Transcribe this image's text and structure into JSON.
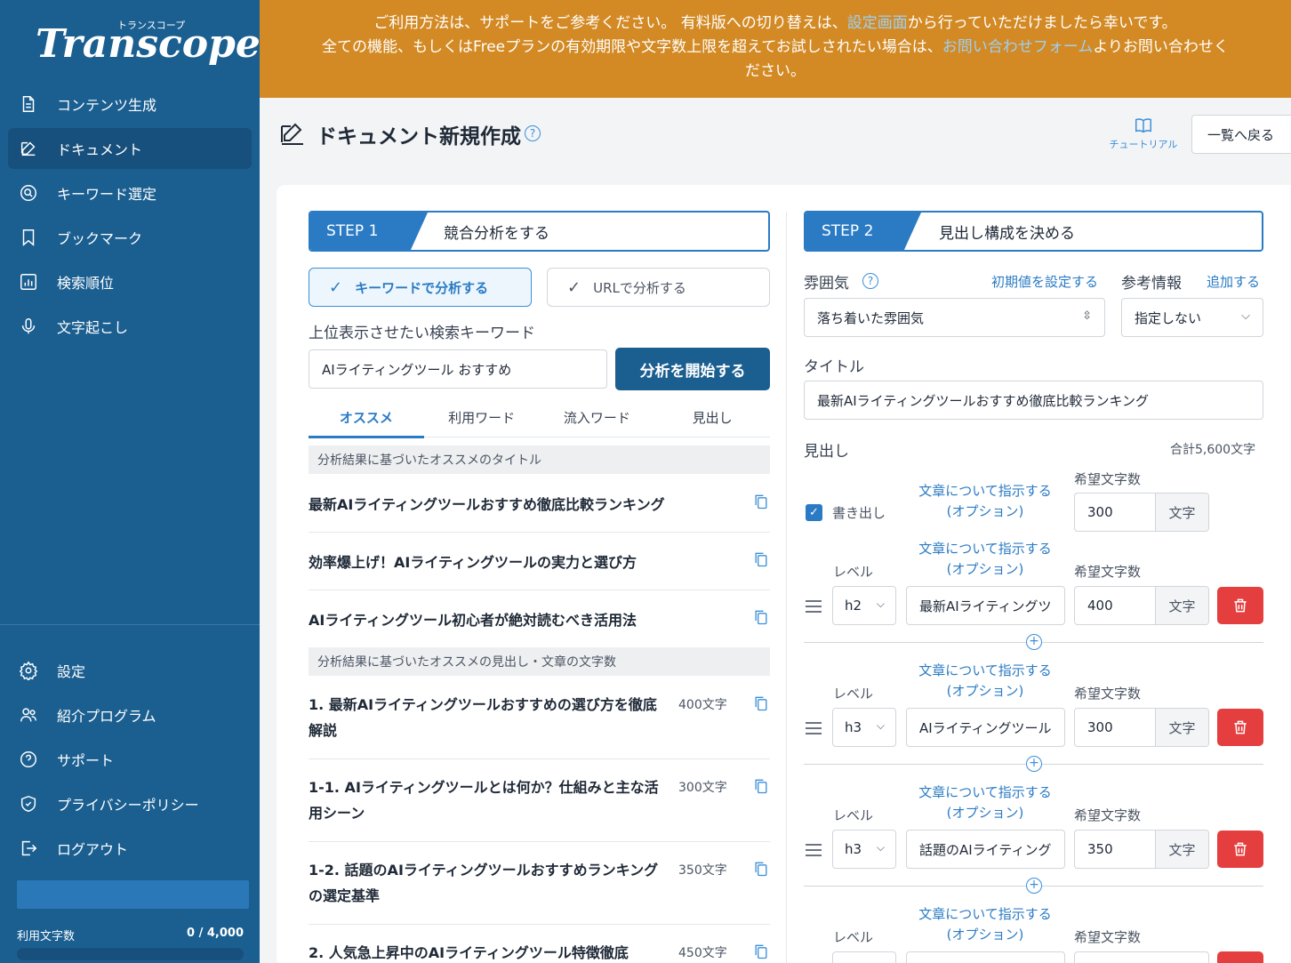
{
  "sidebar": {
    "logo": "Transcope",
    "logo_kana": "トランスコープ",
    "items": [
      {
        "label": "コンテンツ生成",
        "icon": "document-icon"
      },
      {
        "label": "ドキュメント",
        "icon": "edit-icon",
        "active": true
      },
      {
        "label": "キーワード選定",
        "icon": "search-circle-icon"
      },
      {
        "label": "ブックマーク",
        "icon": "bookmark-icon"
      },
      {
        "label": "検索順位",
        "icon": "chart-icon"
      },
      {
        "label": "文字起こし",
        "icon": "microphone-icon"
      }
    ],
    "bottom_items": [
      {
        "label": "設定",
        "icon": "gear-icon"
      },
      {
        "label": "紹介プログラム",
        "icon": "users-icon"
      },
      {
        "label": "サポート",
        "icon": "help-icon"
      },
      {
        "label": "プライバシーポリシー",
        "icon": "shield-icon"
      },
      {
        "label": "ログアウト",
        "icon": "logout-icon"
      }
    ],
    "usage_label": "利用文字数",
    "usage_value": "0 / 4,000"
  },
  "banner": {
    "line1_a": "ご利用方法は、サポートをご参考ください。 有料版への切り替えは、",
    "line1_link": "設定画面",
    "line1_b": "から行っていただけましたら幸いです。",
    "line2_a": "全ての機能、もしくはFreeプランの有効期限や文字数上限を超えてお試しされたい場合は、",
    "line2_link": "お問い合わせフォーム",
    "line2_b": "よりお問い合わせく",
    "line3": "ださい。"
  },
  "header": {
    "title": "ドキュメント新規作成",
    "help": "?",
    "tutorial": "チュートリアル",
    "back": "一覧へ戻る"
  },
  "step1": {
    "badge": "STEP 1",
    "label": "競合分析をする",
    "mode_keyword": "キーワードで分析する",
    "mode_url": "URLで分析する",
    "check": "✓",
    "keyword_label": "上位表示させたい検索キーワード",
    "keyword_value": "AIライティングツール おすすめ",
    "start_button": "分析を開始する",
    "tabs": [
      "オススメ",
      "利用ワード",
      "流入ワード",
      "見出し"
    ],
    "titles_header": "分析結果に基づいたオススメのタイトル",
    "titles": [
      "最新AIライティングツールおすすめ徹底比較ランキング",
      "効率爆上げ！AIライティングツールの実力と選び方",
      "AIライティングツール初心者が絶対読むべき活用法"
    ],
    "headings_header": "分析結果に基づいたオススメの見出し・文章の文字数",
    "headings": [
      {
        "title": "1. 最新AIライティングツールおすすめの選び方を徹底解説",
        "count": "400文字"
      },
      {
        "title": "1-1. AIライティングツールとは何か？仕組みと主な活用シーン",
        "count": "300文字"
      },
      {
        "title": "1-2. 話題のAIライティングツールおすすめランキングの選定基準",
        "count": "350文字"
      },
      {
        "title": "2. 人気急上昇中のAIライティングツール特徴徹底",
        "count": "450文字"
      }
    ]
  },
  "step2": {
    "badge": "STEP 2",
    "label": "見出し構成を決める",
    "mood_label": "雰囲気",
    "mood_help": "?",
    "mood_reset": "初期値を設定する",
    "mood_value": "落ち着いた雰囲気",
    "ref_label": "参考情報",
    "ref_add": "追加する",
    "ref_value": "指定しない",
    "title_label": "タイトル",
    "title_value": "最新AIライティングツールおすすめ徹底比較ランキング",
    "headings_label": "見出し",
    "total": "合計5,600文字",
    "instr_link_1": "文章について指示する",
    "instr_link_2": "(オプション)",
    "level_label": "レベル",
    "desired_label": "希望文字数",
    "unit": "文字",
    "intro_label": "書き出し",
    "intro_checked": "✓",
    "intro_chars": "300",
    "add": "+",
    "rows": [
      {
        "level": "h2",
        "text": "最新AIライティングツ",
        "chars": "400"
      },
      {
        "level": "h3",
        "text": "AIライティングツール",
        "chars": "300"
      },
      {
        "level": "h3",
        "text": "話題のAIライティング",
        "chars": "350"
      }
    ]
  },
  "colors": {
    "sidebar": "#1b5f91",
    "banner": "#d38a24",
    "accent": "#2a7bc4",
    "danger": "#e53e3e"
  }
}
